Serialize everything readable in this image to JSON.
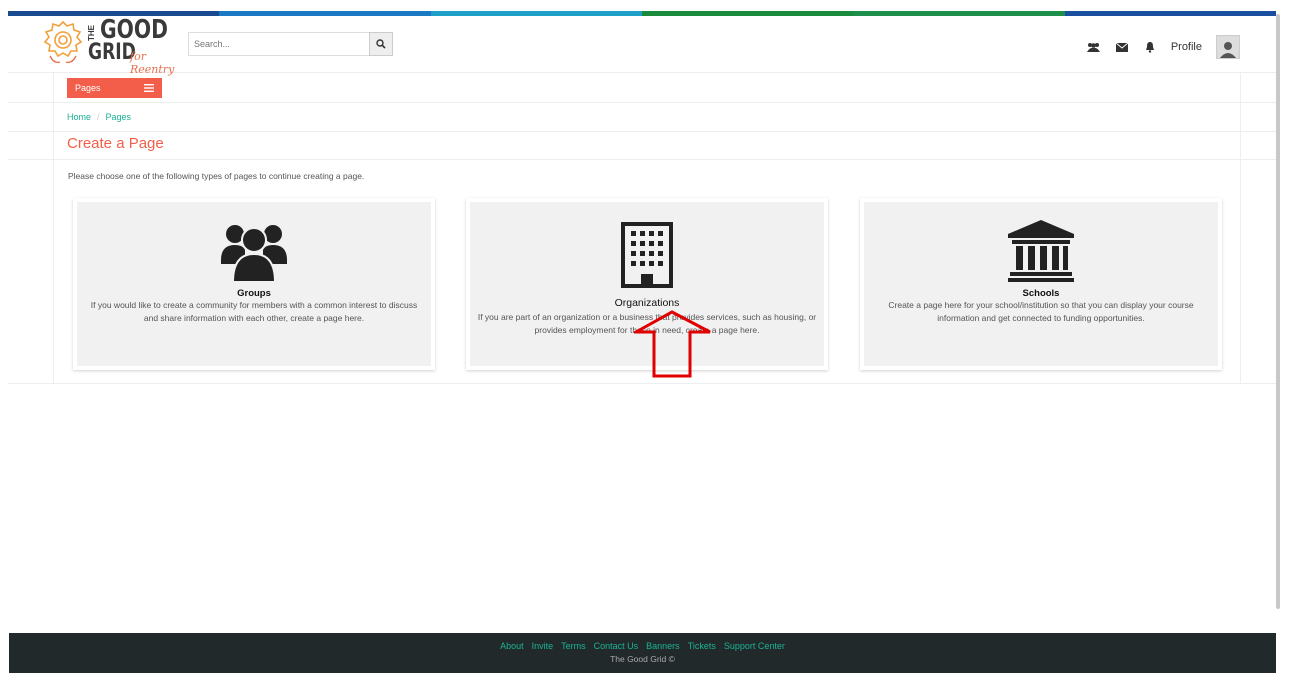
{
  "colors": {
    "accent": "#f25e4a",
    "link": "#1ab394",
    "footer_bg": "#22292b",
    "stripe": [
      "#1a4a8f",
      "#1b78c2",
      "#1fa0c8",
      "#1a8a3c",
      "#1d8f4a",
      "#1a4fa0"
    ]
  },
  "header": {
    "logo": {
      "the": "THE",
      "good": "GOOD",
      "grid": "GRID",
      "sub": "for Reentry"
    },
    "search": {
      "placeholder": "Search..."
    },
    "profile_label": "Profile",
    "icons": [
      "users-icon",
      "envelope-icon",
      "bell-icon",
      "user-avatar-icon"
    ]
  },
  "nav": {
    "pages_button": "Pages"
  },
  "breadcrumb": {
    "home": "Home",
    "sep": "/",
    "current": "Pages"
  },
  "page": {
    "title": "Create a Page",
    "intro": "Please choose one of the following types of pages to continue creating a page."
  },
  "cards": [
    {
      "title": "Groups",
      "icon": "users-icon",
      "desc": "If you would like to create a community for members with a common interest to discuss and share information with each other, create a page here."
    },
    {
      "title": "Organizations",
      "icon": "building-icon",
      "desc": "If you are part of an organization or a business that provides services, such as housing, or provides employment for those in need, create a page here."
    },
    {
      "title": "Schools",
      "icon": "institution-icon",
      "desc": "Create a page here for your school/institution so that you can display your course information and get connected to funding opportunities."
    }
  ],
  "footer": {
    "links": [
      "About",
      "Invite",
      "Terms",
      "Contact Us",
      "Banners",
      "Tickets",
      "Support Center"
    ],
    "copyright": "The Good Grid ©"
  }
}
